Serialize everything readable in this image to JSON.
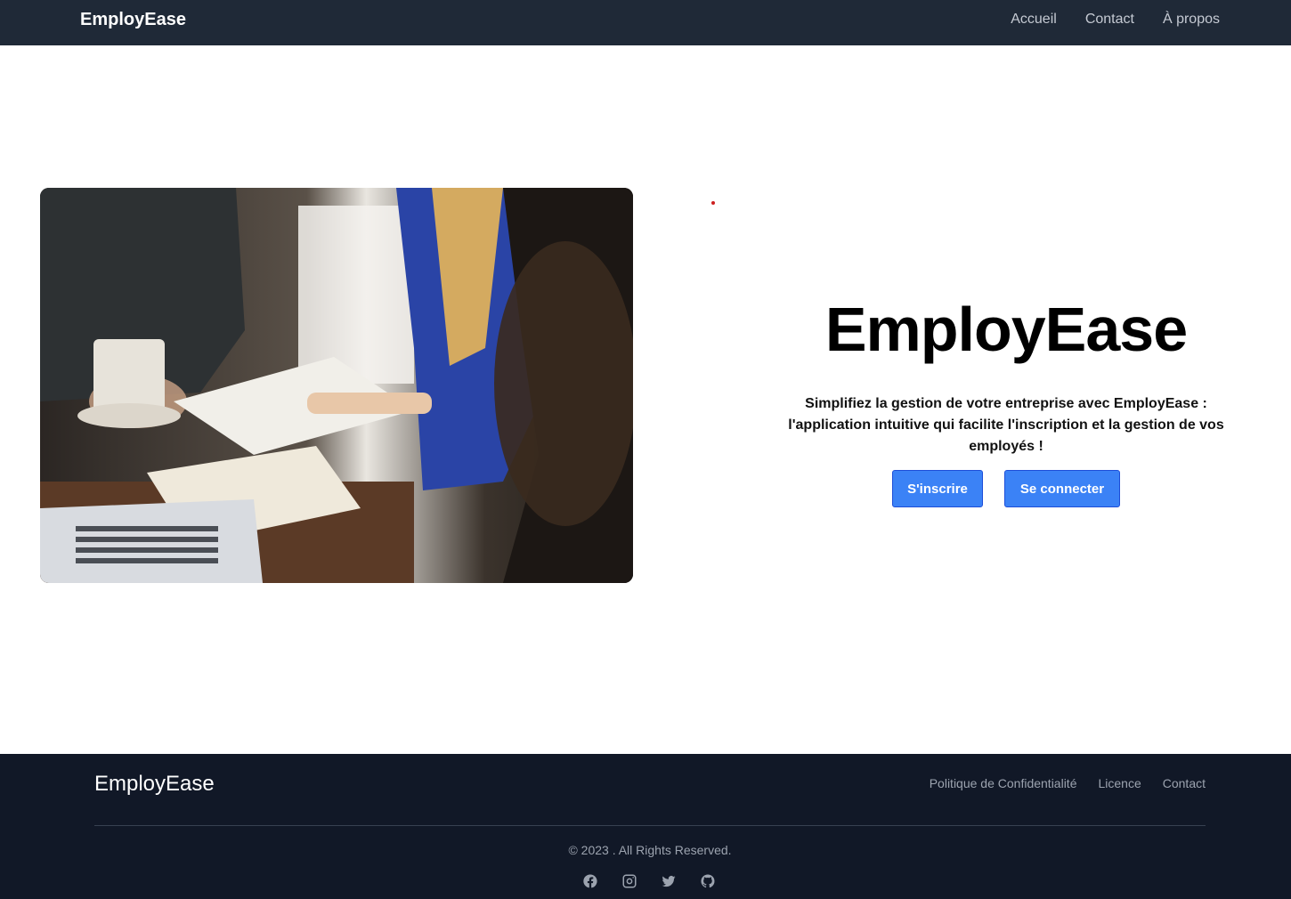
{
  "nav": {
    "brand": "EmployEase",
    "links": [
      "Accueil",
      "Contact",
      "À propos"
    ]
  },
  "hero": {
    "image_icon": "office-meeting-photo",
    "title": "EmployEase",
    "description": "Simplifiez la gestion de votre entreprise avec EmployEase : l'application intuitive qui facilite l'inscription et la gestion de vos employés !",
    "signup_label": "S'inscrire",
    "login_label": "Se connecter"
  },
  "footer": {
    "brand": "EmployEase",
    "links": [
      "Politique de Confidentialité",
      "Licence",
      "Contact"
    ],
    "copyright": "© 2023 . All Rights Reserved.",
    "social_icons": [
      "facebook-icon",
      "instagram-icon",
      "twitter-icon",
      "github-icon"
    ]
  },
  "colors": {
    "nav_bg": "#1f2937",
    "footer_bg": "#111827",
    "button_bg": "#3b82f6"
  }
}
